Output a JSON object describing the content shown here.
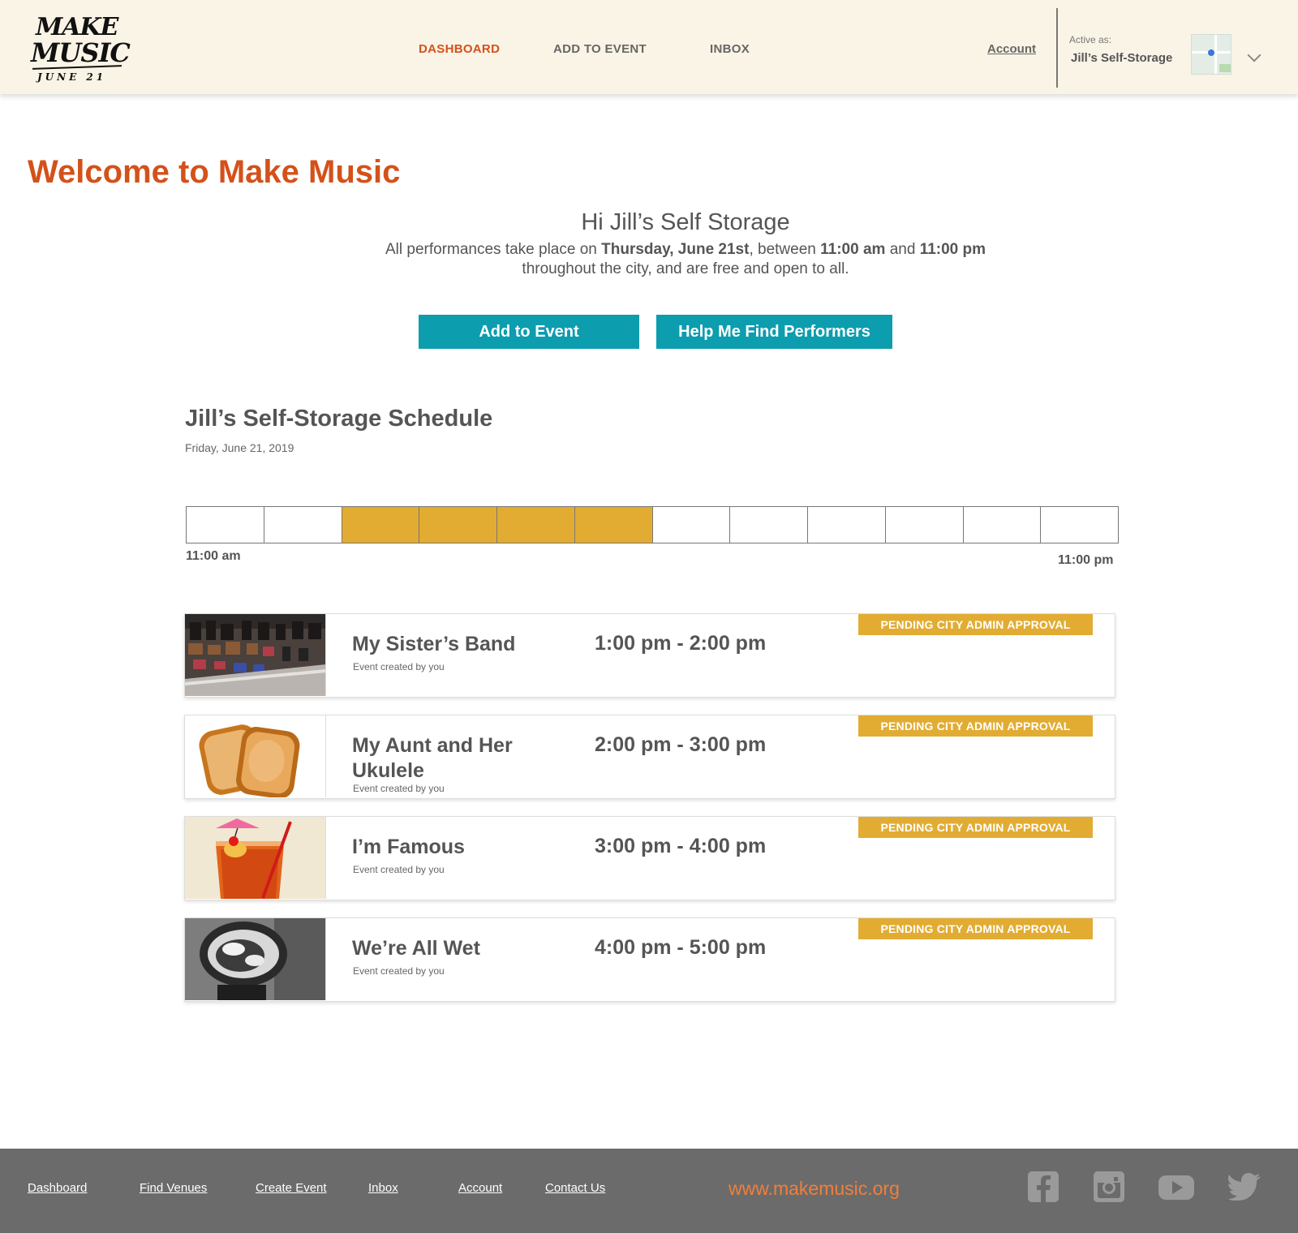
{
  "header": {
    "logo_line1": "MAKE",
    "logo_line2": "MUSIC",
    "logo_line3": "JUNE 21",
    "nav": [
      {
        "label": "DASHBOARD"
      },
      {
        "label": "ADD TO EVENT"
      },
      {
        "label": "INBOX"
      }
    ],
    "account_label": "Account",
    "active_as_label": "Active as:",
    "active_name": "Jill’s Self-Storage"
  },
  "main": {
    "welcome_title": "Welcome to Make Music",
    "greeting": "Hi Jill’s Self Storage",
    "intro_pre": "All performances take place on ",
    "intro_date": "Thursday, June 21st",
    "intro_mid": ", between ",
    "intro_start": "11:00 am",
    "intro_and": " and ",
    "intro_end": "11:00 pm",
    "intro_line2": "throughout the city, and are free and open to all.",
    "add_to_event_button": "Add to Event",
    "find_performers_button": "Help Me Find Performers"
  },
  "schedule": {
    "title": "Jill’s Self-Storage Schedule",
    "date": "Friday, June 21, 2019",
    "timeline_start": "11:00 am",
    "timeline_end": "11:00 pm",
    "slots_busy": [
      false,
      false,
      true,
      true,
      true,
      true,
      false,
      false,
      false,
      false,
      false,
      false
    ]
  },
  "events": [
    {
      "name": "My Sister’s Band",
      "subtitle": "Event created by you",
      "time": "1:00 pm - 2:00 pm",
      "status": "PENDING CITY ADMIN APPROVAL",
      "thumbnail": "shoes-photo"
    },
    {
      "name": "My Aunt and Her Ukulele",
      "subtitle": "Event created by you",
      "time": "2:00 pm - 3:00 pm",
      "status": "PENDING CITY ADMIN APPROVAL",
      "thumbnail": "toast-photo"
    },
    {
      "name": "I’m Famous",
      "subtitle": "Event created by you",
      "time": "3:00 pm - 4:00 pm",
      "status": "PENDING CITY ADMIN APPROVAL",
      "thumbnail": "cocktail-photo"
    },
    {
      "name": "We’re All Wet",
      "subtitle": "Event created by you",
      "time": "4:00 pm - 5:00 pm",
      "status": "PENDING CITY ADMIN APPROVAL",
      "thumbnail": "feather-duster-photo"
    }
  ],
  "footer": {
    "links": [
      {
        "label": "Dashboard"
      },
      {
        "label": "Find Venues"
      },
      {
        "label": "Create Event"
      },
      {
        "label": "Inbox"
      },
      {
        "label": "Account"
      },
      {
        "label": "Contact Us"
      }
    ],
    "site": "www.makemusic.org",
    "social_icons": [
      "facebook-icon",
      "instagram-icon",
      "youtube-icon",
      "twitter-icon"
    ]
  },
  "colors": {
    "accent_orange": "#d4511a",
    "button_teal": "#0c9daf",
    "status_gold": "#e2ac33",
    "header_bg": "#faf4e6",
    "footer_bg": "#6b6b6b",
    "footer_site": "#f07f3c"
  }
}
